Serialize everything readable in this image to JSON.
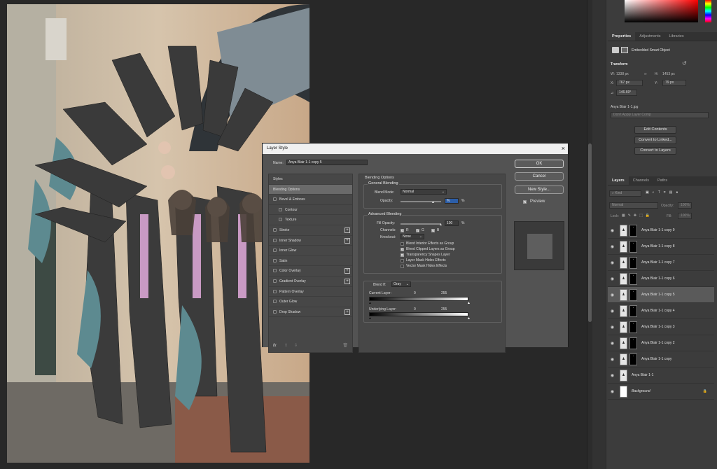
{
  "colors": {
    "canvas_bg": "#282828",
    "panel_bg": "#3c3c3c",
    "dialog_bg": "#535353",
    "selection": "#5a5a5a"
  },
  "properties": {
    "tabs": [
      "Properties",
      "Adjustments",
      "Libraries"
    ],
    "object_type": "Embedded Smart Object",
    "section": "Transform",
    "w_label": "W:",
    "w_value": "1338 px",
    "h_label": "H:",
    "h_value": "1453 px",
    "x_label": "X:",
    "x_value": "767 px",
    "y_label": "Y:",
    "y_value": "79 px",
    "angle_value": "146.69°",
    "file_name": "Anya Blair 1-1.jpg",
    "layer_comp_placeholder": "Don't Apply Layer Comp",
    "buttons": [
      "Edit Contents",
      "Convert to Linked...",
      "Convert to Layers"
    ]
  },
  "layers_panel": {
    "tabs": [
      "Layers",
      "Channels",
      "Paths"
    ],
    "kind_placeholder": "Kind",
    "blend_mode": "Normal",
    "opacity_label": "Opacity:",
    "opacity_value": "100%",
    "lock_label": "Lock:",
    "fill_label": "Fill:",
    "fill_value": "100%",
    "layers": [
      {
        "name": "Anya Blair 1-1 copy 9",
        "selected": false
      },
      {
        "name": "Anya Blair 1-1 copy 8",
        "selected": false
      },
      {
        "name": "Anya Blair 1-1 copy 7",
        "selected": false
      },
      {
        "name": "Anya Blair 1-1 copy 6",
        "selected": false
      },
      {
        "name": "Anya Blair 1-1 copy 5",
        "selected": true
      },
      {
        "name": "Anya Blair 1-1 copy 4",
        "selected": false
      },
      {
        "name": "Anya Blair 1-1 copy 3",
        "selected": false
      },
      {
        "name": "Anya Blair 1-1 copy 2",
        "selected": false
      },
      {
        "name": "Anya Blair 1-1 copy",
        "selected": false
      },
      {
        "name": "Anya Blair 1-1",
        "selected": false
      },
      {
        "name": "Background",
        "selected": false
      }
    ]
  },
  "dialog": {
    "title": "Layer Style",
    "name_label": "Name:",
    "name_value": "Anya Blair 1-1 copy 5",
    "styles_header": "Styles",
    "styles": [
      {
        "label": "Blending Options",
        "selected": true,
        "checkbox": false,
        "plus": false,
        "indent": false
      },
      {
        "label": "Bevel & Emboss",
        "selected": false,
        "checkbox": true,
        "plus": false,
        "indent": false
      },
      {
        "label": "Contour",
        "selected": false,
        "checkbox": true,
        "plus": false,
        "indent": true
      },
      {
        "label": "Texture",
        "selected": false,
        "checkbox": true,
        "plus": false,
        "indent": true
      },
      {
        "label": "Stroke",
        "selected": false,
        "checkbox": true,
        "plus": true,
        "indent": false
      },
      {
        "label": "Inner Shadow",
        "selected": false,
        "checkbox": true,
        "plus": true,
        "indent": false
      },
      {
        "label": "Inner Glow",
        "selected": false,
        "checkbox": true,
        "plus": false,
        "indent": false
      },
      {
        "label": "Satin",
        "selected": false,
        "checkbox": true,
        "plus": false,
        "indent": false
      },
      {
        "label": "Color Overlay",
        "selected": false,
        "checkbox": true,
        "plus": true,
        "indent": false
      },
      {
        "label": "Gradient Overlay",
        "selected": false,
        "checkbox": true,
        "plus": true,
        "indent": false
      },
      {
        "label": "Pattern Overlay",
        "selected": false,
        "checkbox": true,
        "plus": false,
        "indent": false
      },
      {
        "label": "Outer Glow",
        "selected": false,
        "checkbox": true,
        "plus": false,
        "indent": false
      },
      {
        "label": "Drop Shadow",
        "selected": false,
        "checkbox": true,
        "plus": true,
        "indent": false
      }
    ],
    "fx_label": "fx",
    "blending_options_title": "Blending Options",
    "general_blending_title": "General Blending",
    "blend_mode_label": "Blend Mode:",
    "blend_mode_value": "Normal",
    "opacity_label": "Opacity:",
    "opacity_value": "%",
    "opacity_unit": "%",
    "advanced_blending_title": "Advanced Blending",
    "fill_opacity_label": "Fill Opacity:",
    "fill_opacity_value": "100",
    "fill_opacity_unit": "%",
    "channels_label": "Channels:",
    "channel_r": "R",
    "channel_g": "G",
    "channel_b": "B",
    "knockout_label": "Knockout:",
    "knockout_value": "None",
    "options": [
      {
        "label": "Blend Interior Effects as Group",
        "checked": false
      },
      {
        "label": "Blend Clipped Layers as Group",
        "checked": true
      },
      {
        "label": "Transparency Shapes Layer",
        "checked": true
      },
      {
        "label": "Layer Mask Hides Effects",
        "checked": false
      },
      {
        "label": "Vector Mask Hides Effects",
        "checked": false
      }
    ],
    "blend_if_label": "Blend If:",
    "blend_if_value": "Gray",
    "current_layer_label": "Current Layer:",
    "current_layer_min": "0",
    "current_layer_max": "255",
    "underlying_layer_label": "Underlying Layer:",
    "underlying_layer_min": "0",
    "underlying_layer_max": "255",
    "ok_label": "OK",
    "cancel_label": "Cancel",
    "new_style_label": "New Style...",
    "preview_label": "Preview"
  }
}
